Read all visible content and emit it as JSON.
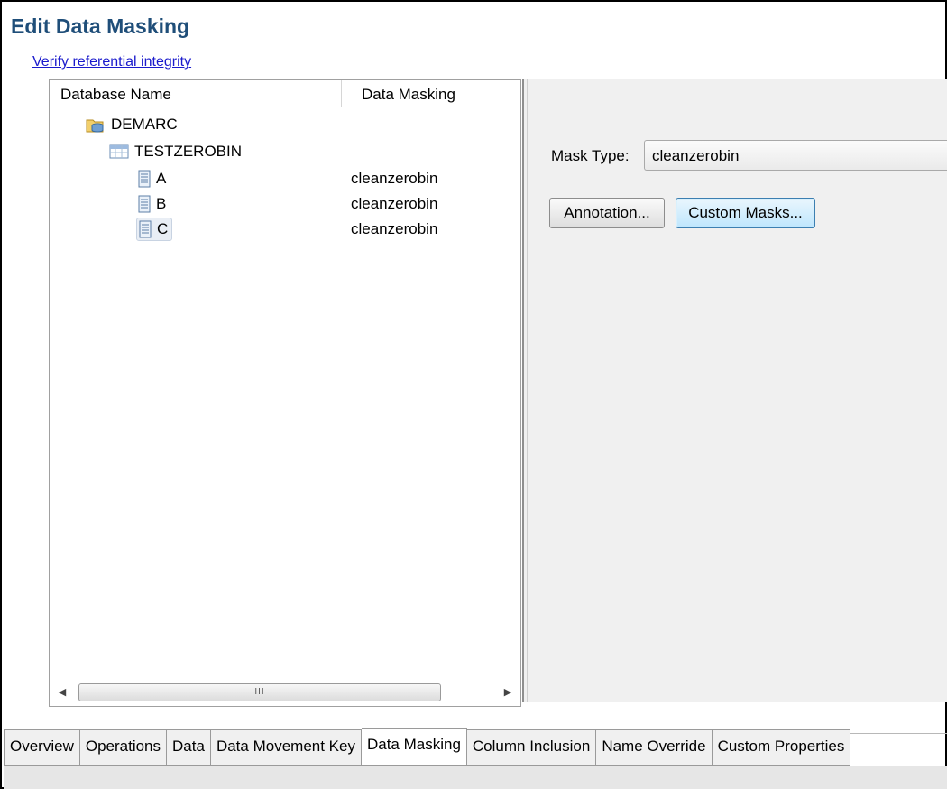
{
  "page": {
    "title": "Edit Data Masking",
    "verify_link": "Verify referential integrity"
  },
  "tree": {
    "columns": [
      "Database Name",
      "Data Masking"
    ],
    "nodes": [
      {
        "label": "DEMARC",
        "mask": "",
        "icon": "database-folder-icon",
        "level": 0
      },
      {
        "label": "TESTZEROBIN",
        "mask": "",
        "icon": "table-icon",
        "level": 1
      },
      {
        "label": "A",
        "mask": "cleanzerobin",
        "icon": "column-icon",
        "level": 2
      },
      {
        "label": "B",
        "mask": "cleanzerobin",
        "icon": "column-icon",
        "level": 2
      },
      {
        "label": "C",
        "mask": "cleanzerobin",
        "icon": "column-icon",
        "level": 2,
        "selected": true
      }
    ],
    "scroll_grip": "III"
  },
  "detail": {
    "mask_type_label": "Mask Type:",
    "mask_type_value": "cleanzerobin",
    "annotation_button": "Annotation...",
    "custom_masks_button": "Custom Masks..."
  },
  "tabs": [
    {
      "label": "Overview",
      "active": false
    },
    {
      "label": "Operations",
      "active": false
    },
    {
      "label": "Data",
      "active": false
    },
    {
      "label": "Data Movement Key",
      "active": false
    },
    {
      "label": "Data Masking",
      "active": true
    },
    {
      "label": "Column Inclusion",
      "active": false
    },
    {
      "label": "Name Override",
      "active": false
    },
    {
      "label": "Custom Properties",
      "active": false
    }
  ],
  "colors": {
    "title": "#1f4e79",
    "link": "#1a1acc",
    "panel_bg": "#f0f0f0",
    "focused_button": "#bee6fd"
  }
}
